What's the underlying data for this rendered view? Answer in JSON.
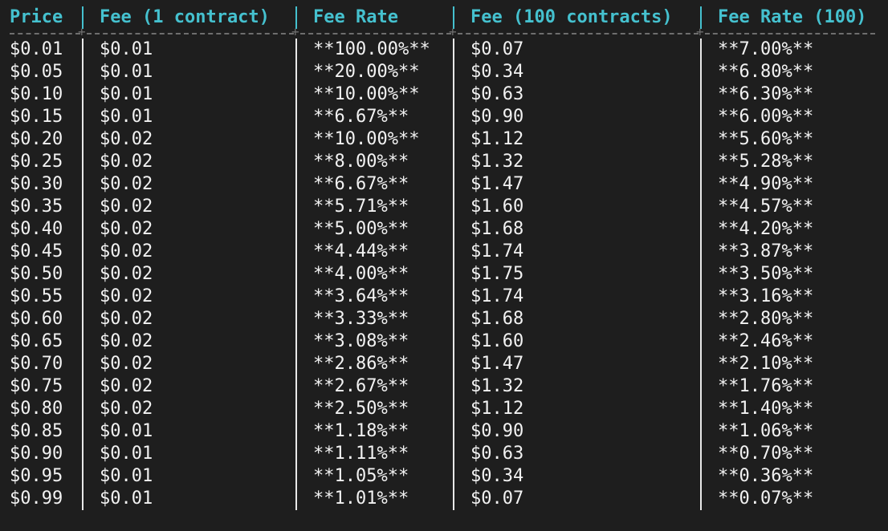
{
  "table": {
    "columns": [
      "Price",
      "Fee (1 contract)",
      "Fee Rate",
      "Fee (100 contracts)",
      "Fee Rate (100)"
    ],
    "rows": [
      [
        "$0.01",
        "$0.01",
        "**100.00%**",
        "$0.07",
        "**7.00%**"
      ],
      [
        "$0.05",
        "$0.01",
        "**20.00%**",
        "$0.34",
        "**6.80%**"
      ],
      [
        "$0.10",
        "$0.01",
        "**10.00%**",
        "$0.63",
        "**6.30%**"
      ],
      [
        "$0.15",
        "$0.01",
        "**6.67%**",
        "$0.90",
        "**6.00%**"
      ],
      [
        "$0.20",
        "$0.02",
        "**10.00%**",
        "$1.12",
        "**5.60%**"
      ],
      [
        "$0.25",
        "$0.02",
        "**8.00%**",
        "$1.32",
        "**5.28%**"
      ],
      [
        "$0.30",
        "$0.02",
        "**6.67%**",
        "$1.47",
        "**4.90%**"
      ],
      [
        "$0.35",
        "$0.02",
        "**5.71%**",
        "$1.60",
        "**4.57%**"
      ],
      [
        "$0.40",
        "$0.02",
        "**5.00%**",
        "$1.68",
        "**4.20%**"
      ],
      [
        "$0.45",
        "$0.02",
        "**4.44%**",
        "$1.74",
        "**3.87%**"
      ],
      [
        "$0.50",
        "$0.02",
        "**4.00%**",
        "$1.75",
        "**3.50%**"
      ],
      [
        "$0.55",
        "$0.02",
        "**3.64%**",
        "$1.74",
        "**3.16%**"
      ],
      [
        "$0.60",
        "$0.02",
        "**3.33%**",
        "$1.68",
        "**2.80%**"
      ],
      [
        "$0.65",
        "$0.02",
        "**3.08%**",
        "$1.60",
        "**2.46%**"
      ],
      [
        "$0.70",
        "$0.02",
        "**2.86%**",
        "$1.47",
        "**2.10%**"
      ],
      [
        "$0.75",
        "$0.02",
        "**2.67%**",
        "$1.32",
        "**1.76%**"
      ],
      [
        "$0.80",
        "$0.02",
        "**2.50%**",
        "$1.12",
        "**1.40%**"
      ],
      [
        "$0.85",
        "$0.01",
        "**1.18%**",
        "$0.90",
        "**1.06%**"
      ],
      [
        "$0.90",
        "$0.01",
        "**1.11%**",
        "$0.63",
        "**0.70%**"
      ],
      [
        "$0.95",
        "$0.01",
        "**1.05%**",
        "$0.34",
        "**0.36%**"
      ],
      [
        "$0.99",
        "$0.01",
        "**1.01%**",
        "$0.07",
        "**0.07%**"
      ]
    ]
  },
  "colors": {
    "background": "#1e1e1e",
    "header_text": "#45c1cf",
    "body_text": "#f2f2f2",
    "separator": "#6e6e6e"
  }
}
